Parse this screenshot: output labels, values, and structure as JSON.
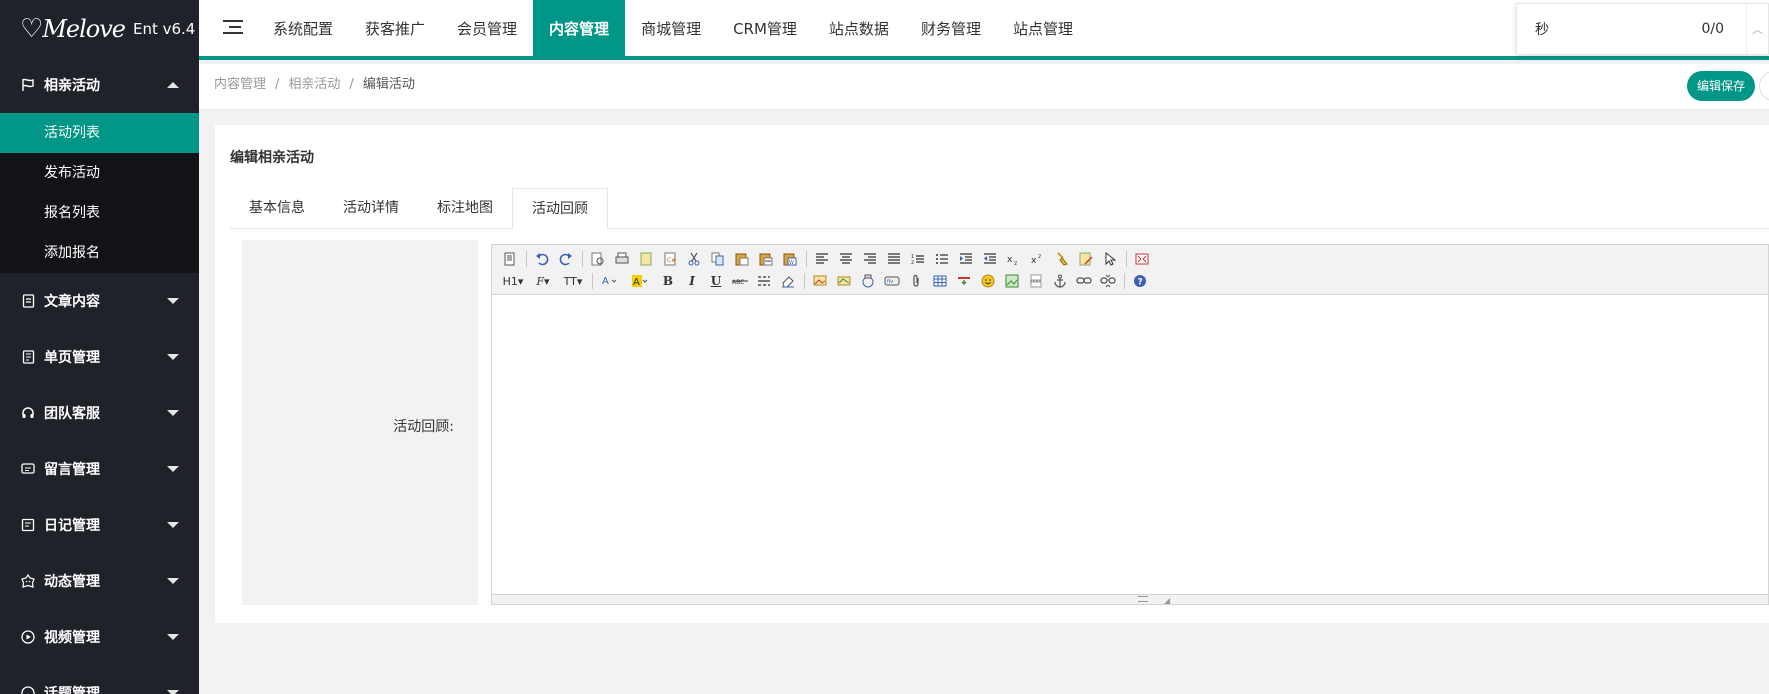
{
  "brand": {
    "logo_text": "Melove",
    "version": "Ent v6.4"
  },
  "sidebar": {
    "groups": [
      {
        "label": "相亲活动",
        "icon": "flag-icon",
        "expanded": true,
        "items": [
          {
            "label": "活动列表",
            "active": true
          },
          {
            "label": "发布活动"
          },
          {
            "label": "报名列表"
          },
          {
            "label": "添加报名"
          }
        ]
      },
      {
        "label": "文章内容",
        "icon": "article-icon"
      },
      {
        "label": "单页管理",
        "icon": "page-icon"
      },
      {
        "label": "团队客服",
        "icon": "headset-icon"
      },
      {
        "label": "留言管理",
        "icon": "message-icon"
      },
      {
        "label": "日记管理",
        "icon": "diary-icon"
      },
      {
        "label": "动态管理",
        "icon": "moment-icon"
      },
      {
        "label": "视频管理",
        "icon": "video-play-icon"
      },
      {
        "label": "话题管理",
        "icon": "topic-icon"
      }
    ]
  },
  "topnav": {
    "items": [
      "系统配置",
      "获客推广",
      "会员管理",
      "内容管理",
      "商城管理",
      "CRM管理",
      "站点数据",
      "财务管理",
      "站点管理"
    ],
    "active_index": 3
  },
  "countdown": {
    "left": "秒",
    "right": "0/0"
  },
  "breadcrumb": [
    "内容管理",
    "相亲活动",
    "编辑活动"
  ],
  "header_actions": {
    "save_label": "编辑保存"
  },
  "card": {
    "title": "编辑相亲活动",
    "tabs": [
      "基本信息",
      "活动详情",
      "标注地图",
      "活动回顾"
    ],
    "active_tab": 3,
    "field_label": "活动回顾:"
  },
  "editor": {
    "heading_btn": "H1",
    "font_btn": "F",
    "size_btn": "TT",
    "content": ""
  },
  "colors": {
    "accent": "#009688",
    "sidebar_bg": "#20222a",
    "sidebar_sub_bg": "#121317"
  }
}
